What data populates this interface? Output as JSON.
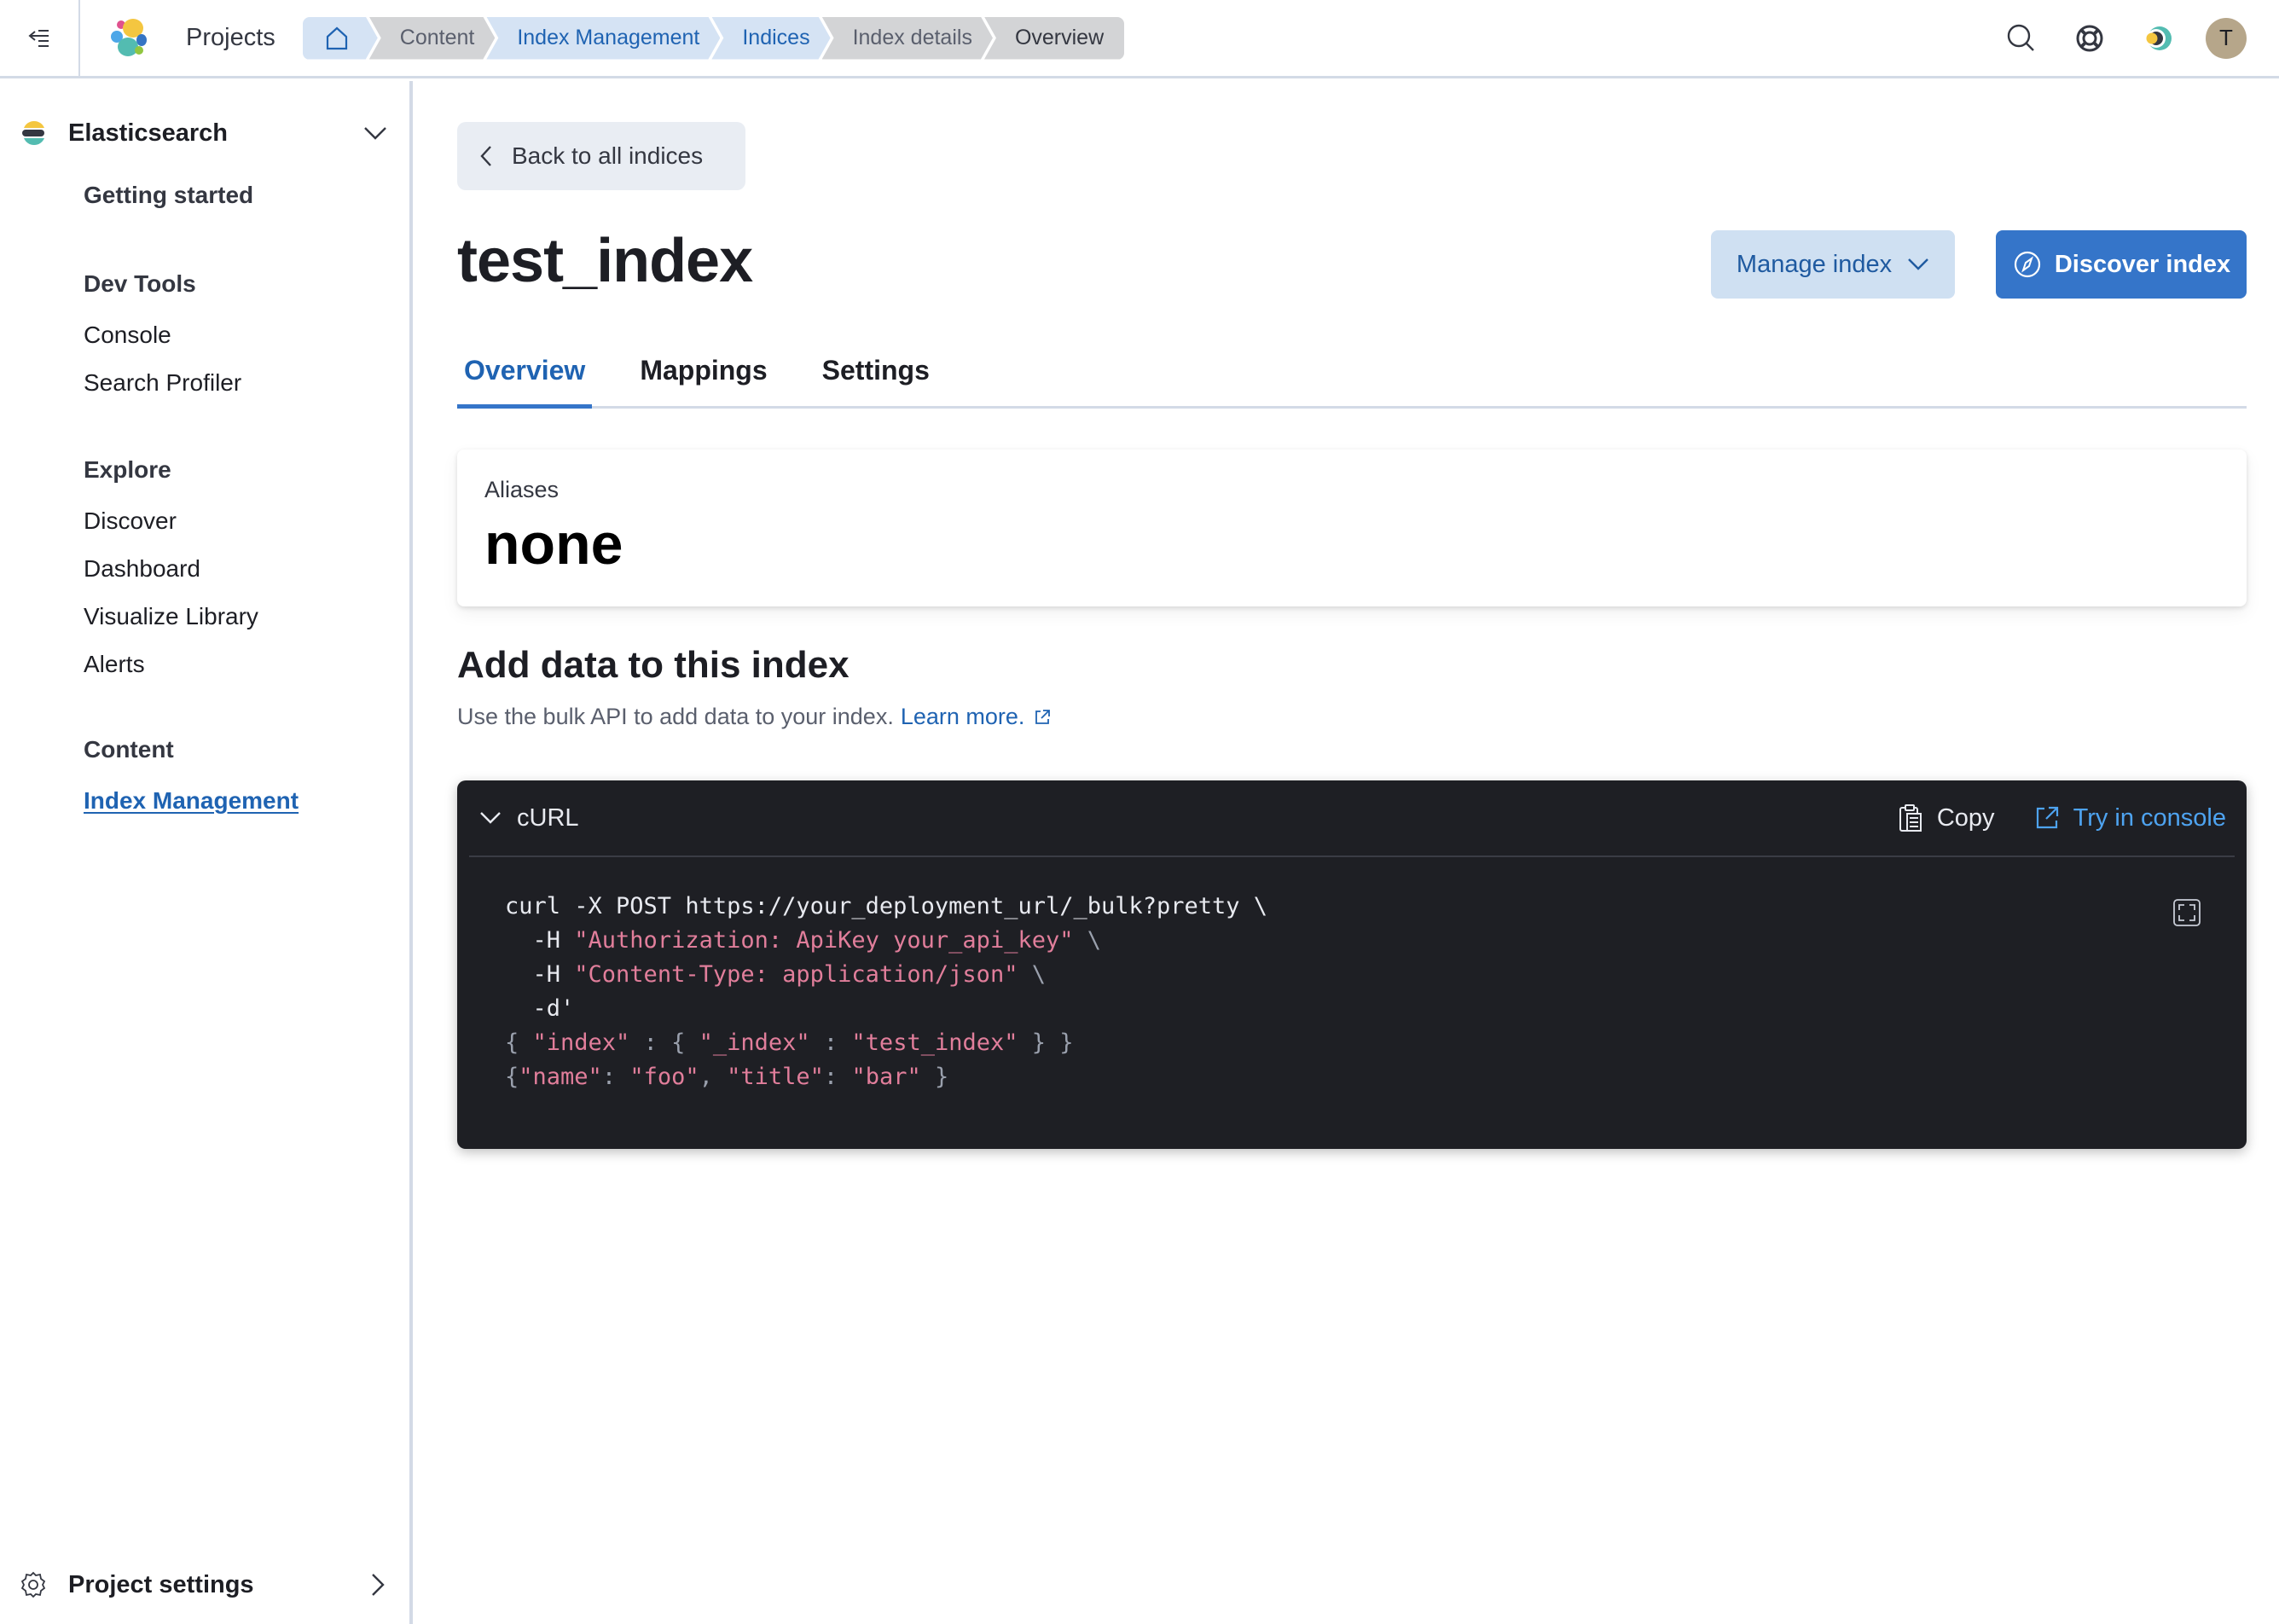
{
  "header": {
    "projects_label": "Projects",
    "breadcrumbs": [
      {
        "label": "",
        "icon": "home-icon"
      },
      {
        "label": "Content"
      },
      {
        "label": "Index Management"
      },
      {
        "label": "Indices"
      },
      {
        "label": "Index details"
      },
      {
        "label": "Overview"
      }
    ],
    "avatar_initial": "T",
    "icons": [
      "search-icon",
      "help-lifebuoy-icon",
      "ai-assistant-icon"
    ]
  },
  "sidebar": {
    "solution": "Elasticsearch",
    "getting_started": "Getting started",
    "groups": [
      {
        "title": "Dev Tools",
        "items": [
          "Console",
          "Search Profiler"
        ]
      },
      {
        "title": "Explore",
        "items": [
          "Discover",
          "Dashboard",
          "Visualize Library",
          "Alerts"
        ]
      },
      {
        "title": "Content",
        "items": [
          "Index Management"
        ]
      }
    ],
    "active_item": "Index Management",
    "footer": "Project settings"
  },
  "main": {
    "back_label": "Back to all indices",
    "title": "test_index",
    "manage_label": "Manage index",
    "discover_label": "Discover index",
    "tabs": [
      {
        "label": "Overview",
        "active": true
      },
      {
        "label": "Mappings",
        "active": false
      },
      {
        "label": "Settings",
        "active": false
      }
    ],
    "aliases": {
      "label": "Aliases",
      "value": "none"
    },
    "add_data": {
      "title": "Add data to this index",
      "description": "Use the bulk API to add data to your index.",
      "learn_more": "Learn more."
    },
    "code": {
      "language_label": "cURL",
      "copy_label": "Copy",
      "try_label": "Try in console",
      "lines": {
        "l1": "curl -X POST https://your_deployment_url/_bulk?pretty \\",
        "l2_flag": "  -H ",
        "l2_str": "\"Authorization: ApiKey your_api_key\"",
        "l2_end": " \\",
        "l3_flag": "  -H ",
        "l3_str": "\"Content-Type: application/json\"",
        "l3_end": " \\",
        "l4": "  -d'",
        "l5_a": "{ ",
        "l5_b": "\"index\"",
        "l5_c": " : { ",
        "l5_d": "\"_index\"",
        "l5_e": " : ",
        "l5_f": "\"test_index\"",
        "l5_g": " } }",
        "l6_a": "{",
        "l6_b": "\"name\"",
        "l6_c": ": ",
        "l6_d": "\"foo\"",
        "l6_e": ", ",
        "l6_f": "\"title\"",
        "l6_g": ": ",
        "l6_h": "\"bar\"",
        "l6_i": " }"
      }
    }
  },
  "colors": {
    "accent": "#3575c9",
    "link": "#1f63b2",
    "code_bg": "#1e1f24",
    "code_string": "#e17e9b"
  }
}
